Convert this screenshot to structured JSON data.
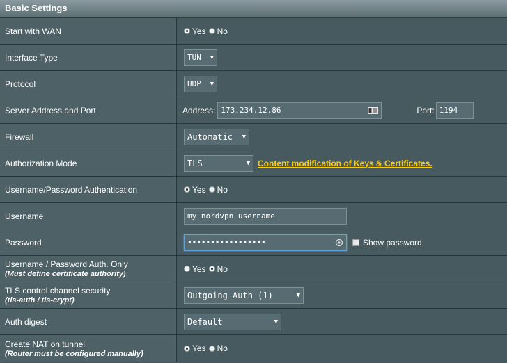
{
  "header": {
    "title": "Basic Settings"
  },
  "start_with_wan": {
    "label": "Start with WAN",
    "yes": "Yes",
    "no": "No",
    "selected": "yes"
  },
  "interface_type": {
    "label": "Interface Type",
    "value": "TUN"
  },
  "protocol": {
    "label": "Protocol",
    "value": "UDP"
  },
  "server": {
    "label": "Server Address and Port",
    "address_label": "Address:",
    "address": "173.234.12.86",
    "port_label": "Port:",
    "port": "1194"
  },
  "firewall": {
    "label": "Firewall",
    "value": "Automatic"
  },
  "auth_mode": {
    "label": "Authorization Mode",
    "value": "TLS",
    "link": "Content modification of Keys & Certificates."
  },
  "userpass_auth": {
    "label": "Username/Password Authentication",
    "yes": "Yes",
    "no": "No",
    "selected": "yes"
  },
  "username": {
    "label": "Username",
    "value": "my nordvpn username"
  },
  "password": {
    "label": "Password",
    "value": "•••••••••••••••••",
    "show_label": "Show password"
  },
  "auth_only": {
    "label": "Username / Password Auth. Only",
    "note": "(Must define certificate authority)",
    "yes": "Yes",
    "no": "No",
    "selected": "no"
  },
  "tls_control": {
    "label": "TLS control channel security",
    "note": "(tls-auth / tls-crypt)",
    "value": "Outgoing Auth (1)"
  },
  "auth_digest": {
    "label": "Auth digest",
    "value": "Default"
  },
  "create_nat": {
    "label": "Create NAT on tunnel",
    "note": "(Router must be configured manually)",
    "yes": "Yes",
    "no": "No",
    "selected": "yes"
  }
}
